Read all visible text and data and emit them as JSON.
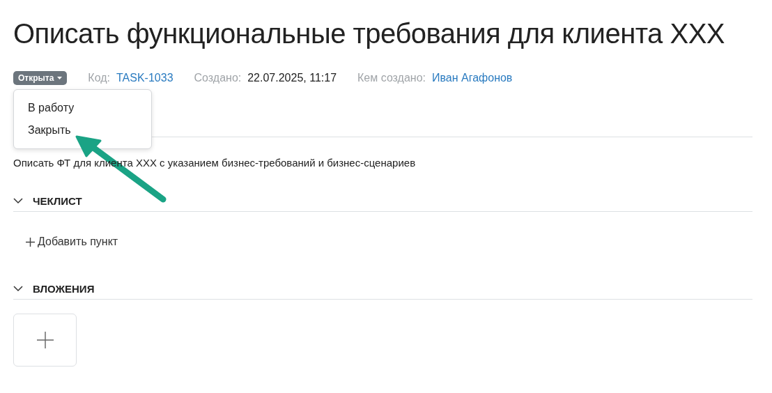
{
  "title": "Описать функциональные требования для клиента XXX",
  "status": {
    "label": "Открыта",
    "expanded": true
  },
  "meta": [
    {
      "label": "Код:",
      "value": "TASK-1033",
      "kind": "link"
    },
    {
      "label": "Создано:",
      "value": "22.07.2025, 11:17",
      "kind": "text"
    },
    {
      "label": "Кем создано:",
      "value": "Иван Агафонов",
      "kind": "link"
    }
  ],
  "status_menu": [
    "В работу",
    "Закрыть"
  ],
  "description": "Описать ФТ для клиента XXX с указанием бизнес-требований и бизнес-сценариев",
  "checklist": {
    "title": "ЧЕКЛИСТ",
    "expanded": true,
    "add_label": "Добавить пункт"
  },
  "attachments": {
    "title": "ВЛОЖЕНИЯ",
    "expanded": true
  }
}
